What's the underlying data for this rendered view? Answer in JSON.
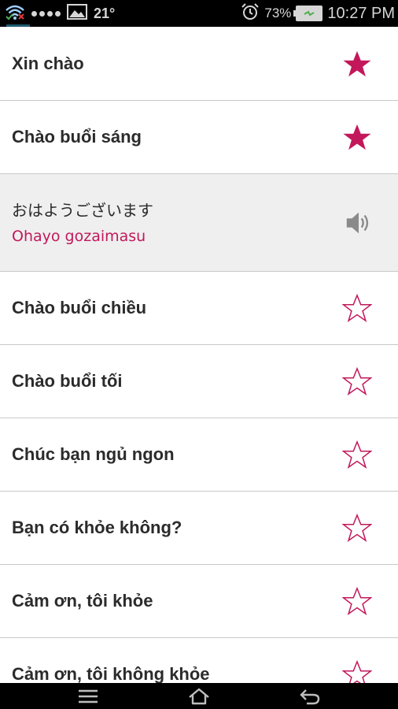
{
  "status_bar": {
    "temperature": "21°",
    "battery_percent": "73%",
    "time": "10:27 PM"
  },
  "colors": {
    "accent": "#c2185b",
    "star_filled": "#c2185b",
    "text": "#2b2b2b",
    "expanded_bg": "#efefef"
  },
  "phrases": [
    {
      "label": "Xin chào",
      "favorite": true
    },
    {
      "label": "Chào buổi sáng",
      "favorite": true
    },
    {
      "native": "おはようございます",
      "romaji": "Ohayo gozaimasu",
      "expanded": true,
      "icon": "speaker-icon"
    },
    {
      "label": "Chào buổi chiều",
      "favorite": false
    },
    {
      "label": "Chào buổi tối",
      "favorite": false
    },
    {
      "label": "Chúc bạn ngủ ngon",
      "favorite": false
    },
    {
      "label": "Bạn có khỏe không?",
      "favorite": false
    },
    {
      "label": "Cảm ơn, tôi khỏe",
      "favorite": false
    },
    {
      "label": "Cảm ơn, tôi không khỏe",
      "favorite": false
    }
  ],
  "nav_bar": {
    "icons": [
      "menu-icon",
      "home-icon",
      "back-icon"
    ]
  }
}
